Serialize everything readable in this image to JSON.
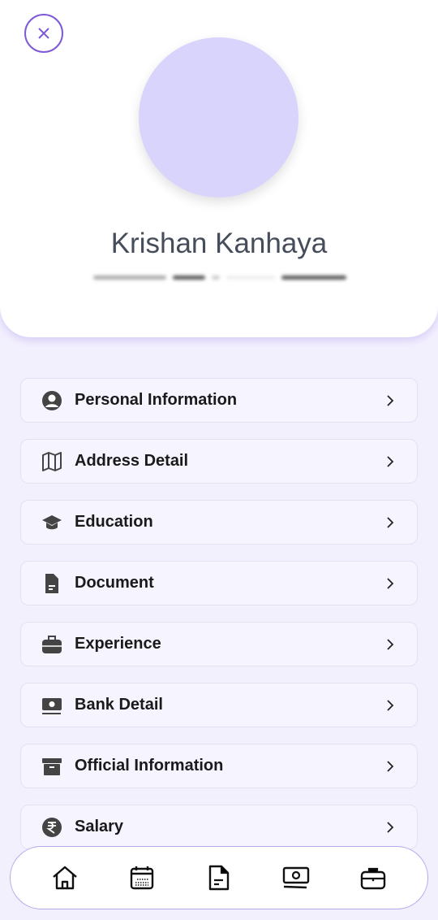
{
  "profile": {
    "name": "Krishan Kanhaya"
  },
  "colors": {
    "accent": "#7e5ad6",
    "avatar": "#d9d4fb",
    "background": "#f3f0fe"
  },
  "menu": [
    {
      "label": "Personal Information",
      "icon": "user-circle-icon"
    },
    {
      "label": "Address Detail",
      "icon": "map-icon"
    },
    {
      "label": "Education",
      "icon": "graduation-cap-icon"
    },
    {
      "label": "Document",
      "icon": "file-icon"
    },
    {
      "label": "Experience",
      "icon": "briefcase-icon"
    },
    {
      "label": "Bank Detail",
      "icon": "money-icon"
    },
    {
      "label": "Official Information",
      "icon": "archive-icon"
    },
    {
      "label": "Salary",
      "icon": "rupee-icon"
    }
  ],
  "nav": [
    "home-icon",
    "calendar-icon",
    "document-icon",
    "money-icon",
    "briefcase-icon"
  ]
}
